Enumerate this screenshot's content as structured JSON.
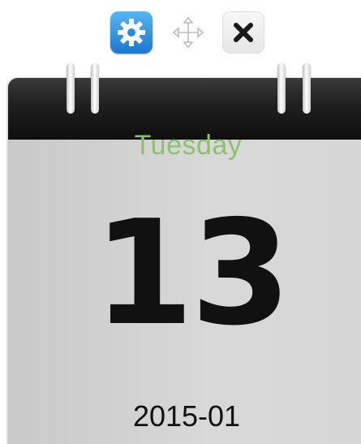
{
  "toolbar": {
    "settings_icon": "gear-icon",
    "move_icon": "move-arrows-icon",
    "close_icon": "close-icon",
    "settings_color": "#2a8ae0"
  },
  "calendar": {
    "weekday": "Tuesday",
    "day": "13",
    "year_month": "2015-01",
    "weekday_color": "#8cc36a",
    "header_color": "#1a1a1a",
    "page_color": "#d4d4d4"
  }
}
